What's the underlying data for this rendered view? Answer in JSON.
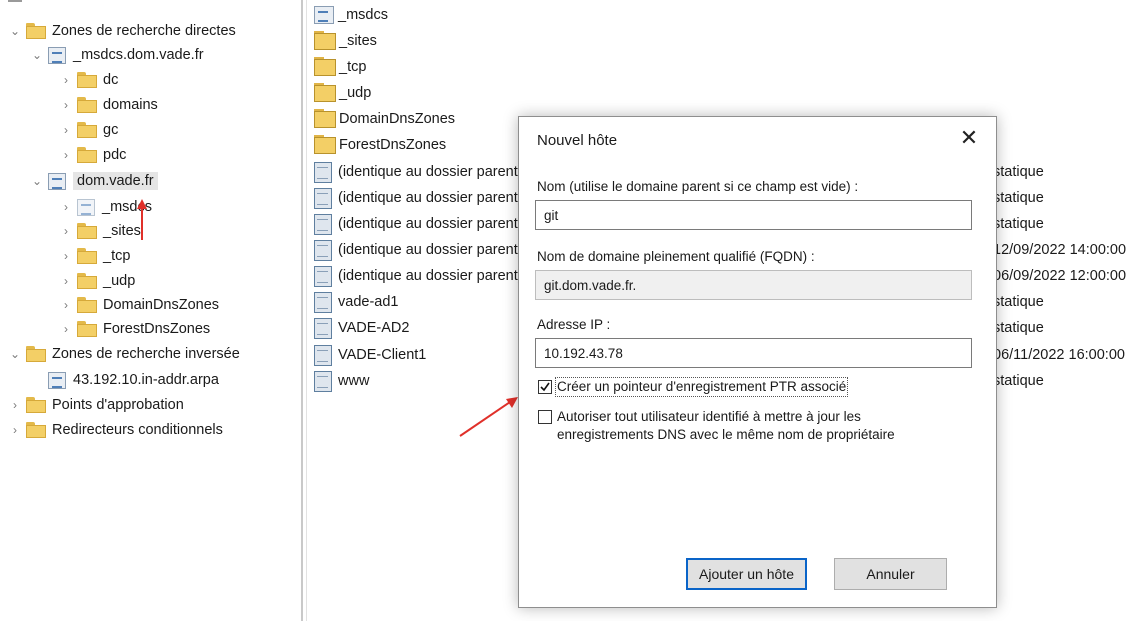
{
  "tree": {
    "items": [
      {
        "label": "Zones de recherche directes",
        "chevron": "down",
        "icon": "folder"
      },
      {
        "label": "_msdcs.dom.vade.fr",
        "chevron": "down",
        "icon": "zone"
      },
      {
        "label": "dc",
        "chevron": "right",
        "icon": "folder"
      },
      {
        "label": "domains",
        "chevron": "right",
        "icon": "folder"
      },
      {
        "label": "gc",
        "chevron": "right",
        "icon": "folder"
      },
      {
        "label": "pdc",
        "chevron": "right",
        "icon": "folder"
      },
      {
        "label": "dom.vade.fr",
        "chevron": "down",
        "icon": "zone"
      },
      {
        "label": "_msdcs",
        "chevron": "right",
        "icon": "zone"
      },
      {
        "label": "_sites",
        "chevron": "right",
        "icon": "folder"
      },
      {
        "label": "_tcp",
        "chevron": "right",
        "icon": "folder"
      },
      {
        "label": "_udp",
        "chevron": "right",
        "icon": "folder"
      },
      {
        "label": "DomainDnsZones",
        "chevron": "right",
        "icon": "folder"
      },
      {
        "label": "ForestDnsZones",
        "chevron": "right",
        "icon": "folder"
      },
      {
        "label": "Zones de recherche inversée",
        "chevron": "down",
        "icon": "folder"
      },
      {
        "label": "43.192.10.in-addr.arpa",
        "chevron": "none",
        "icon": "zone"
      },
      {
        "label": "Points d'approbation",
        "chevron": "right",
        "icon": "folder"
      },
      {
        "label": "Redirecteurs conditionnels",
        "chevron": "right",
        "icon": "folder"
      }
    ]
  },
  "list": {
    "items": [
      {
        "name": "_msdcs",
        "icon": "zone-folder",
        "value": ""
      },
      {
        "name": "_sites",
        "icon": "folder",
        "value": ""
      },
      {
        "name": "_tcp",
        "icon": "folder",
        "value": ""
      },
      {
        "name": "_udp",
        "icon": "folder",
        "value": ""
      },
      {
        "name": "DomainDnsZones",
        "icon": "folder",
        "value": ""
      },
      {
        "name": "ForestDnsZones",
        "icon": "folder",
        "value": ""
      },
      {
        "name": "(identique au dossier parent)",
        "icon": "record",
        "value": "statique"
      },
      {
        "name": "(identique au dossier parent)",
        "icon": "record",
        "value": "statique"
      },
      {
        "name": "(identique au dossier parent)",
        "icon": "record",
        "value": "statique"
      },
      {
        "name": "(identique au dossier parent)",
        "icon": "record",
        "value": "12/09/2022 14:00:00"
      },
      {
        "name": "(identique au dossier parent)",
        "icon": "record",
        "value": "06/09/2022 12:00:00"
      },
      {
        "name": "vade-ad1",
        "icon": "record",
        "value": "statique"
      },
      {
        "name": "VADE-AD2",
        "icon": "record",
        "value": "statique"
      },
      {
        "name": "VADE-Client1",
        "icon": "record",
        "value": "06/11/2022 16:00:00"
      },
      {
        "name": "www",
        "icon": "record",
        "value": "statique"
      }
    ]
  },
  "dialog": {
    "title": "Nouvel hôte",
    "close_glyph": "✕",
    "name_label": "Nom (utilise le domaine parent si ce champ est vide) :",
    "name_value": "git",
    "fqdn_label": "Nom de domaine pleinement qualifié (FQDN) :",
    "fqdn_value": "git.dom.vade.fr.",
    "ip_label": "Adresse IP :",
    "ip_value": "10.192.43.78",
    "ptr_label": "Créer un pointeur d'enregistrement PTR associé",
    "ptr_checked": true,
    "auth_label": "Autoriser tout utilisateur identifié à mettre à jour les enregistrements DNS avec le même nom de propriétaire",
    "auth_checked": false,
    "add_button": "Ajouter un hôte",
    "cancel_button": "Annuler"
  },
  "colors": {
    "annotation_arrow": "#e0302a",
    "accent": "#0a64c8"
  }
}
